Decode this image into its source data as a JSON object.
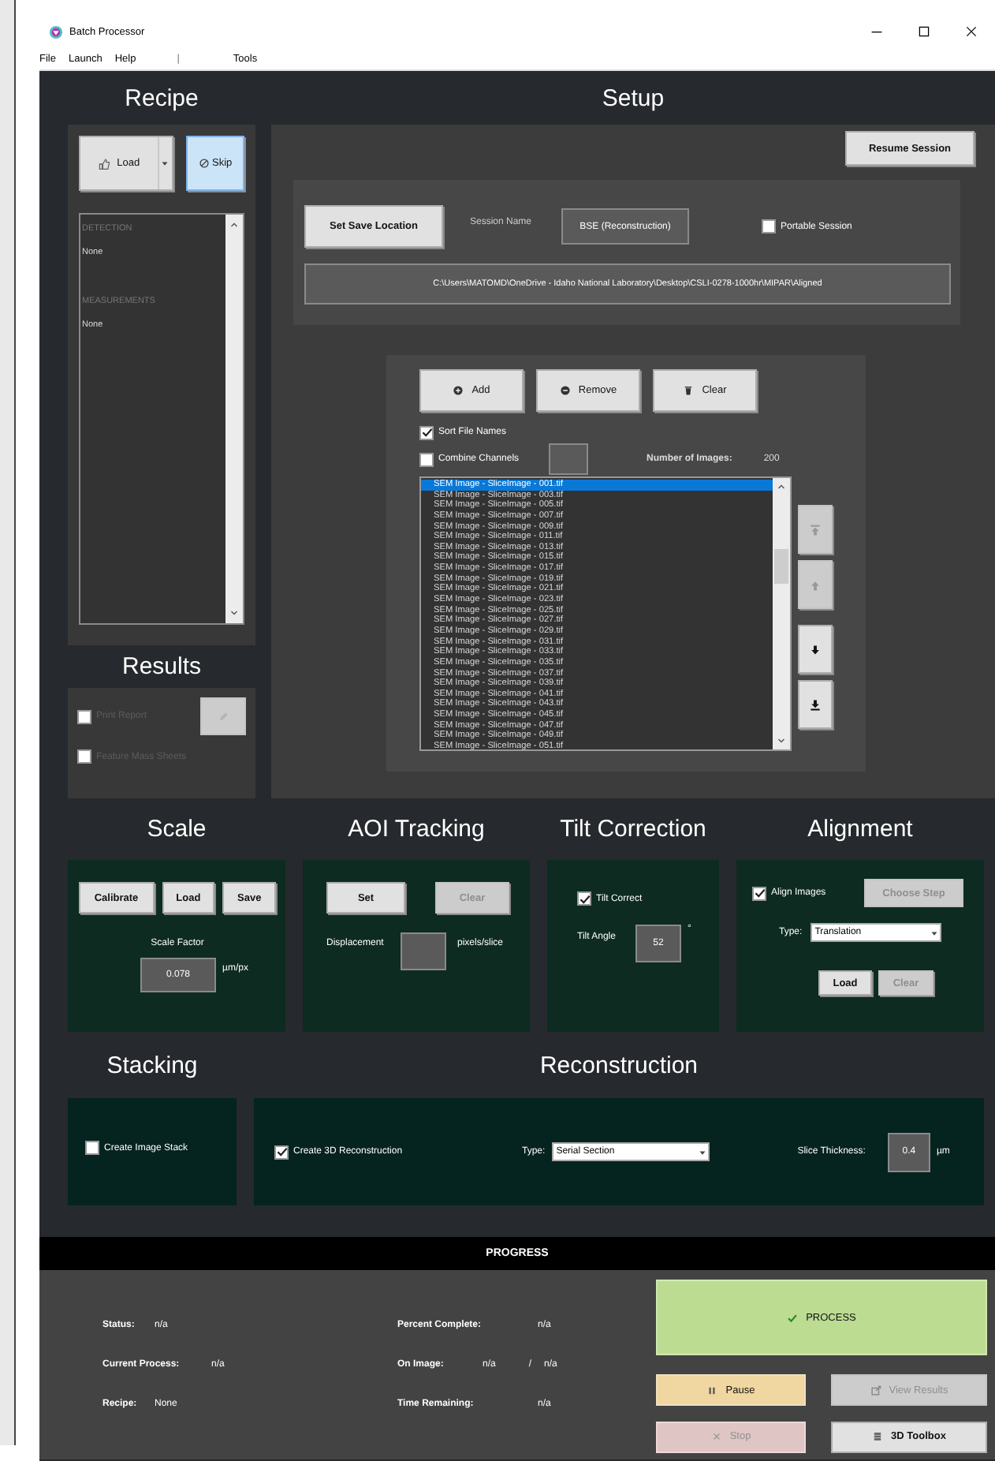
{
  "window": {
    "title": "Batch Processor"
  },
  "menu": [
    "File",
    "Launch",
    "Help",
    "|",
    "Tools"
  ],
  "recipe": {
    "title": "Recipe",
    "load_button": "Load",
    "skip_button": {
      "label": "Skip",
      "selected": true
    },
    "sections": [
      {
        "heading": "DETECTION",
        "value": "None"
      },
      {
        "heading": "MEASUREMENTS",
        "value": "None"
      }
    ]
  },
  "results": {
    "title": "Results",
    "edit_button": {
      "disabled": true
    },
    "options": [
      {
        "label": "Print Report",
        "checked": false,
        "disabled": true
      },
      {
        "label": "Feature Mass Sheets",
        "checked": false,
        "disabled": true
      }
    ]
  },
  "setup": {
    "title": "Setup",
    "resume_button": "Resume Session",
    "save_location_button": "Set Save Location",
    "session_name_label": "Session Name",
    "session_name": "BSE (Reconstruction)",
    "portable_session": {
      "label": "Portable Session",
      "checked": false
    },
    "save_path": "C:\\Users\\MATOMD\\OneDrive - Idaho National Laboratory\\Desktop\\CSLI-0278-1000hr\\MIPAR\\Aligned",
    "file_buttons": [
      {
        "label": "Add",
        "kind": "add"
      },
      {
        "label": "Remove",
        "kind": "remove"
      },
      {
        "label": "Clear",
        "kind": "clear"
      }
    ],
    "sort_file_names": {
      "label": "Sort File Names",
      "checked": true
    },
    "combine_channels": {
      "label": "Combine Channels",
      "checked": false
    },
    "number_of_images_label": "Number of Images:",
    "number_of_images": "200",
    "files": [
      {
        "name": "SEM Image - SliceImage - 001.tif",
        "selected": true
      },
      {
        "name": "SEM Image - SliceImage - 003.tif",
        "selected": false
      },
      {
        "name": "SEM Image - SliceImage - 005.tif",
        "selected": false
      },
      {
        "name": "SEM Image - SliceImage - 007.tif",
        "selected": false
      },
      {
        "name": "SEM Image - SliceImage - 009.tif",
        "selected": false
      },
      {
        "name": "SEM Image - SliceImage - 011.tif",
        "selected": false
      },
      {
        "name": "SEM Image - SliceImage - 013.tif",
        "selected": false
      },
      {
        "name": "SEM Image - SliceImage - 015.tif",
        "selected": false
      },
      {
        "name": "SEM Image - SliceImage - 017.tif",
        "selected": false
      },
      {
        "name": "SEM Image - SliceImage - 019.tif",
        "selected": false
      },
      {
        "name": "SEM Image - SliceImage - 021.tif",
        "selected": false
      },
      {
        "name": "SEM Image - SliceImage - 023.tif",
        "selected": false
      },
      {
        "name": "SEM Image - SliceImage - 025.tif",
        "selected": false
      },
      {
        "name": "SEM Image - SliceImage - 027.tif",
        "selected": false
      },
      {
        "name": "SEM Image - SliceImage - 029.tif",
        "selected": false
      },
      {
        "name": "SEM Image - SliceImage - 031.tif",
        "selected": false
      },
      {
        "name": "SEM Image - SliceImage - 033.tif",
        "selected": false
      },
      {
        "name": "SEM Image - SliceImage - 035.tif",
        "selected": false
      },
      {
        "name": "SEM Image - SliceImage - 037.tif",
        "selected": false
      },
      {
        "name": "SEM Image - SliceImage - 039.tif",
        "selected": false
      },
      {
        "name": "SEM Image - SliceImage - 041.tif",
        "selected": false
      },
      {
        "name": "SEM Image - SliceImage - 043.tif",
        "selected": false
      },
      {
        "name": "SEM Image - SliceImage - 045.tif",
        "selected": false
      },
      {
        "name": "SEM Image - SliceImage - 047.tif",
        "selected": false
      },
      {
        "name": "SEM Image - SliceImage - 049.tif",
        "selected": false
      },
      {
        "name": "SEM Image - SliceImage - 051.tif",
        "selected": false
      }
    ],
    "move_buttons": [
      {
        "kind": "top",
        "disabled": true
      },
      {
        "kind": "up",
        "disabled": true
      },
      {
        "kind": "down",
        "disabled": false
      },
      {
        "kind": "bottom",
        "disabled": false
      }
    ]
  },
  "scale": {
    "title": "Scale",
    "buttons": [
      "Calibrate",
      "Load",
      "Save"
    ],
    "factor_label": "Scale Factor",
    "factor": "0.078",
    "unit": "µm/px"
  },
  "aoi_tracking": {
    "title": "AOI Tracking",
    "set_button": {
      "label": "Set",
      "disabled": false
    },
    "clear_button": {
      "label": "Clear",
      "disabled": true
    },
    "displacement_label": "Displacement",
    "unit": "pixels/slice"
  },
  "tilt_correction": {
    "title": "Tilt Correction",
    "tilt_correct": {
      "label": "Tilt Correct",
      "checked": true
    },
    "angle_label": "Tilt Angle",
    "angle": "52",
    "unit": "°"
  },
  "alignment": {
    "title": "Alignment",
    "align_images": {
      "label": "Align Images",
      "checked": true
    },
    "choose_step": {
      "label": "Choose Step",
      "disabled": true
    },
    "type_label": "Type:",
    "type": "Translation",
    "load_button": {
      "label": "Load",
      "disabled": false
    },
    "clear_button": {
      "label": "Clear",
      "disabled": true
    }
  },
  "stacking": {
    "title": "Stacking",
    "create_stack": {
      "label": "Create Image Stack",
      "checked": false
    }
  },
  "reconstruction": {
    "title": "Reconstruction",
    "create_3d": {
      "label": "Create 3D Reconstruction",
      "checked": true
    },
    "type_label": "Type:",
    "type": "Serial Section",
    "thickness_label": "Slice Thickness:",
    "thickness": "0.4",
    "unit": "µm"
  },
  "progress": {
    "title": "PROGRESS",
    "fields": [
      {
        "label": "Status:",
        "values": [
          "n/a"
        ]
      },
      {
        "label": "Current Process:",
        "values": [
          "n/a"
        ]
      },
      {
        "label": "Recipe:",
        "values": [
          "None"
        ]
      },
      {
        "label": "Percent Complete:",
        "values": [
          "n/a"
        ]
      },
      {
        "label": "On Image:",
        "values": [
          "n/a",
          "/",
          "n/a"
        ]
      },
      {
        "label": "Time Remaining:",
        "values": [
          "n/a"
        ]
      }
    ],
    "buttons": [
      {
        "label": "PROCESS",
        "kind": "process",
        "disabled": false
      },
      {
        "label": "Pause",
        "kind": "pause",
        "disabled": false
      },
      {
        "label": "View Results",
        "kind": "results",
        "disabled": true
      },
      {
        "label": "Stop",
        "kind": "stop",
        "disabled": true
      },
      {
        "label": "3D Toolbox",
        "kind": "toolbox",
        "disabled": false
      }
    ]
  }
}
